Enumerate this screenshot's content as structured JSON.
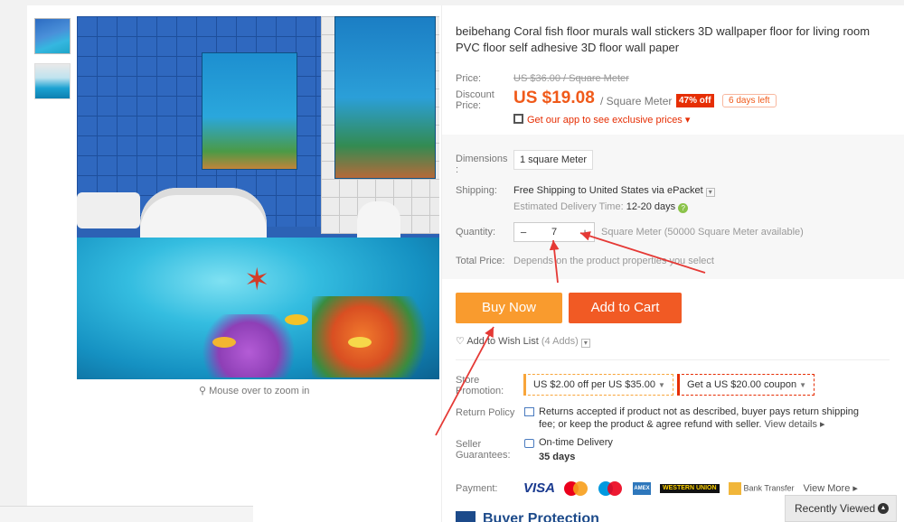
{
  "product": {
    "title": "beibehang Coral fish floor murals wall stickers 3D wallpaper floor for living room PVC floor self adhesive 3D floor wall paper"
  },
  "gallery": {
    "zoom_hint": "Mouse over to zoom in"
  },
  "price": {
    "label": "Price:",
    "original": "US $36.00 / Square Meter",
    "discount_label": "Discount Price:",
    "current": "US $19.08",
    "unit": "/ Square Meter",
    "off_badge": "47% off",
    "days_left": "6 days left",
    "app_promo": "Get our app to see exclusive prices"
  },
  "options": {
    "dimensions_label": "Dimensions :",
    "dimensions_value": "1 square Meter",
    "shipping_label": "Shipping:",
    "shipping_text": "Free Shipping to United States via ePacket",
    "delivery_label": "Estimated Delivery Time:",
    "delivery_value": "12-20 days",
    "quantity_label": "Quantity:",
    "quantity_minus": "−",
    "quantity_value": "7",
    "quantity_plus": "+",
    "availability": "Square Meter (50000 Square Meter available)",
    "total_label": "Total Price:",
    "total_note": "Depends on the product properties you select"
  },
  "actions": {
    "buy_now": "Buy Now",
    "add_to_cart": "Add to Cart",
    "wish_list": "Add to Wish List",
    "wish_count": "(4 Adds)"
  },
  "promotion": {
    "label": "Store Promotion:",
    "coupon1": "US $2.00 off per US $35.00",
    "coupon2": "Get a US $20.00 coupon"
  },
  "policy": {
    "return_label": "Return Policy",
    "return_text": "Returns accepted if product not as described, buyer pays return shipping fee; or keep the product & agree refund with seller.",
    "view_details": "View details",
    "seller_label": "Seller Guarantees:",
    "guarantee_1": "On-time Delivery",
    "guarantee_2": "35 days"
  },
  "payment": {
    "label": "Payment:",
    "visa": "VISA",
    "amex": "AMEX",
    "western_union": "WESTERN UNION",
    "bank": "Bank Transfer",
    "view_more": "View More"
  },
  "footer": {
    "buyer_protection": "Buyer Protection",
    "recently_viewed": "Recently Viewed"
  },
  "colors": {
    "price": "#f05a1a",
    "buy_now": "#f99b2e",
    "add_to_cart": "#f15a24",
    "badge": "#e62e04",
    "arrow": "#e53935"
  }
}
